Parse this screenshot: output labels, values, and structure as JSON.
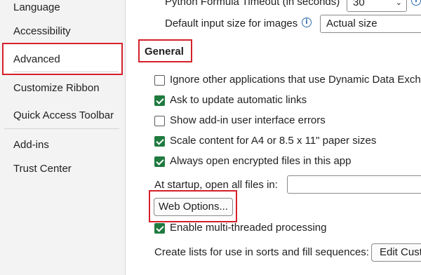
{
  "sidebar": {
    "items": [
      {
        "label": "Language"
      },
      {
        "label": "Accessibility"
      },
      {
        "label": "Advanced",
        "selected": true
      },
      {
        "label": "Customize Ribbon"
      },
      {
        "label": "Quick Access Toolbar"
      },
      {
        "label": "Add-ins"
      },
      {
        "label": "Trust Center"
      }
    ]
  },
  "main": {
    "python_timeout": {
      "label": "Python Formula Timeout (in seconds)",
      "value": "30"
    },
    "default_image_size": {
      "label": "Default input size for images",
      "value": "Actual size"
    },
    "section_title": "General",
    "options": [
      {
        "label": "Ignore other applications that use Dynamic Data Excha",
        "checked": false
      },
      {
        "label": "Ask to update automatic links",
        "checked": true
      },
      {
        "label": "Show add-in user interface errors",
        "checked": false
      },
      {
        "label": "Scale content for A4 or 8.5 x 11\" paper sizes",
        "checked": true
      },
      {
        "label": "Always open encrypted files in this app",
        "checked": true
      }
    ],
    "startup": {
      "label": "At startup, open all files in:",
      "value": ""
    },
    "web_options_label": "Web Options...",
    "multithread": {
      "label": "Enable multi-threaded processing",
      "checked": true
    },
    "custom_lists": {
      "label": "Create lists for use in sorts and fill sequences:",
      "button_label": "Edit Cust"
    }
  },
  "colors": {
    "highlight_red": "#d5202a",
    "checkbox_green": "#1f7a3e",
    "info_blue": "#2b6cb0"
  },
  "icons": [
    "info-icon",
    "chevron-down-icon",
    "checkmark-icon"
  ]
}
